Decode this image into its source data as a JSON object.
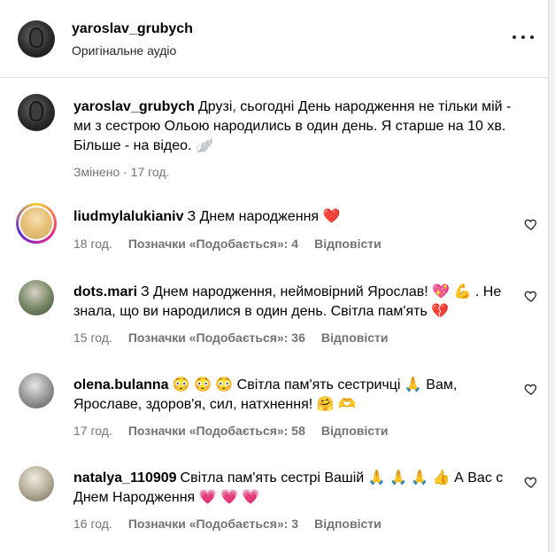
{
  "header": {
    "username": "yaroslav_grubych",
    "subtitle": "Оригінальне аудіо"
  },
  "caption": {
    "username": "yaroslav_grubych",
    "text": "Друзі, сьогодні День народження не тільки мій - ми з сестрою Ольою народились в один день. Я старше на 10 хв. Більше - на відео. 🪽",
    "meta": "Змінено · 17 год."
  },
  "comments": [
    {
      "username": "liudmylalukianiv",
      "text": "З Днем народження  ❤️",
      "time": "18 год.",
      "likes": "Позначки «Подобається»: 4",
      "reply": "Відповісти",
      "avatar_color": "#e8c27a"
    },
    {
      "username": "dots.mari",
      "text": "З Днем народження, неймовірний Ярослав! 💖 💪 . Не знала, що ви народилися в один день. Світла пам'ять 💔",
      "time": "15 год.",
      "likes": "Позначки «Подобається»: 36",
      "reply": "Відповісти",
      "avatar_color": "#7d8c6a"
    },
    {
      "username": "olena.bulanna",
      "text": "😳 😳 😳  Світла пам'ять сестричці 🙏 Вам, Ярославе, здоров'я, сил, натхнення! 🤗 🫶",
      "time": "17 год.",
      "likes": "Позначки «Подобається»: 58",
      "reply": "Відповісти",
      "avatar_color": "#8d8d8d"
    },
    {
      "username": "natalya_110909",
      "text": "Світла пам'ять сестрі Вашій  🙏 🙏 🙏 👍 А Вас с Днем Народження  💗 💗 💗",
      "time": "16 год.",
      "likes": "Позначки «Подобається»: 3",
      "reply": "Відповісти",
      "avatar_color": "#b7b09a"
    }
  ]
}
